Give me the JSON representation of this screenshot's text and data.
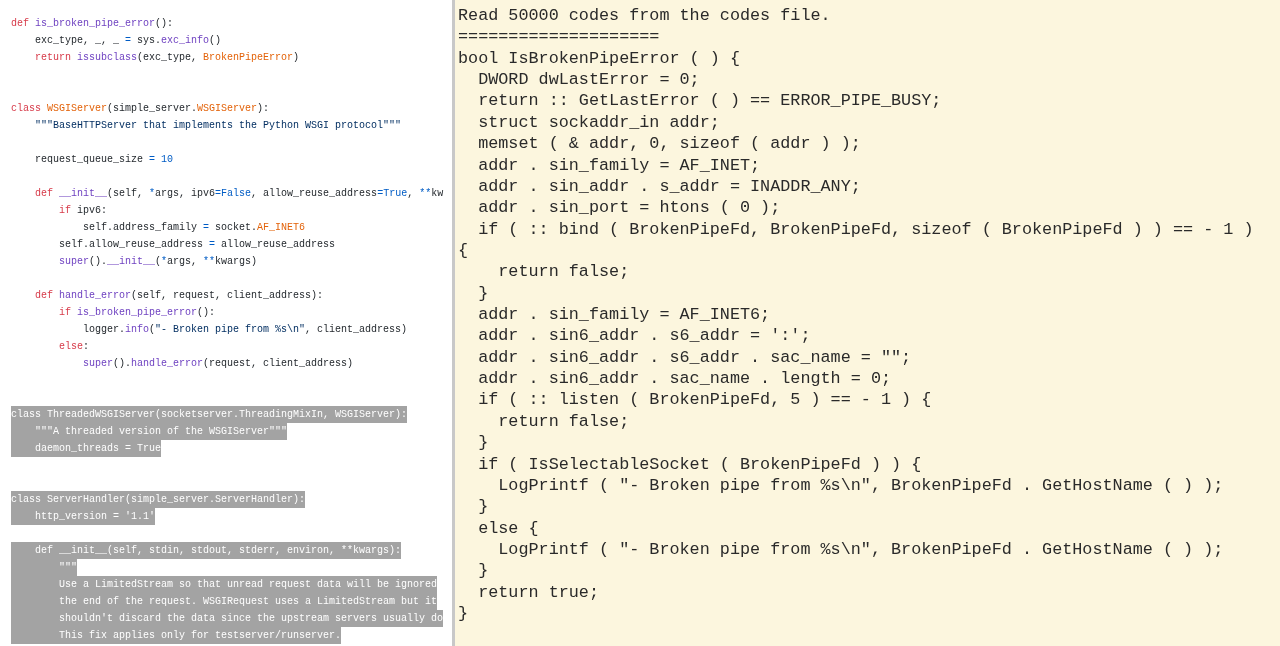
{
  "source_panel": {
    "lines": [
      {
        "kind": "code",
        "selected": false,
        "tokens": [
          {
            "kind": "keyword",
            "text": "def "
          },
          {
            "kind": "function",
            "text": "is_broken_pipe_error"
          },
          {
            "kind": "plain",
            "text": "():"
          }
        ]
      },
      {
        "kind": "code",
        "selected": false,
        "tokens": [
          {
            "kind": "plain",
            "text": "    exc_type, _, _ "
          },
          {
            "kind": "operator",
            "text": "="
          },
          {
            "kind": "plain",
            "text": " sys."
          },
          {
            "kind": "function",
            "text": "exc_info"
          },
          {
            "kind": "plain",
            "text": "()"
          }
        ]
      },
      {
        "kind": "code",
        "selected": false,
        "tokens": [
          {
            "kind": "keyword",
            "text": "    return "
          },
          {
            "kind": "function",
            "text": "issubclass"
          },
          {
            "kind": "plain",
            "text": "(exc_type, "
          },
          {
            "kind": "class",
            "text": "BrokenPipeError"
          },
          {
            "kind": "plain",
            "text": ")"
          }
        ]
      },
      {
        "kind": "blank"
      },
      {
        "kind": "blank"
      },
      {
        "kind": "code",
        "selected": false,
        "tokens": [
          {
            "kind": "keyword",
            "text": "class "
          },
          {
            "kind": "class",
            "text": "WSGIServer"
          },
          {
            "kind": "plain",
            "text": "(simple_server."
          },
          {
            "kind": "class",
            "text": "WSGIServer"
          },
          {
            "kind": "plain",
            "text": "):"
          }
        ]
      },
      {
        "kind": "code",
        "selected": false,
        "tokens": [
          {
            "kind": "string",
            "text": "    \"\"\"BaseHTTPServer that implements the Python WSGI protocol\"\"\""
          }
        ]
      },
      {
        "kind": "blank"
      },
      {
        "kind": "code",
        "selected": false,
        "tokens": [
          {
            "kind": "plain",
            "text": "    request_queue_size "
          },
          {
            "kind": "operator",
            "text": "= 10"
          }
        ]
      },
      {
        "kind": "blank"
      },
      {
        "kind": "code",
        "selected": false,
        "tokens": [
          {
            "kind": "keyword",
            "text": "    def "
          },
          {
            "kind": "function",
            "text": "__init__"
          },
          {
            "kind": "plain",
            "text": "(self, "
          },
          {
            "kind": "operator",
            "text": "*"
          },
          {
            "kind": "plain",
            "text": "args, ipv6"
          },
          {
            "kind": "operator",
            "text": "=False"
          },
          {
            "kind": "plain",
            "text": ", allow_reuse_address"
          },
          {
            "kind": "operator",
            "text": "=True"
          },
          {
            "kind": "plain",
            "text": ", "
          },
          {
            "kind": "operator",
            "text": "**"
          },
          {
            "kind": "plain",
            "text": "kw"
          }
        ]
      },
      {
        "kind": "code",
        "selected": false,
        "tokens": [
          {
            "kind": "keyword",
            "text": "        if "
          },
          {
            "kind": "plain",
            "text": "ipv6:"
          }
        ]
      },
      {
        "kind": "code",
        "selected": false,
        "tokens": [
          {
            "kind": "plain",
            "text": "            self.address_family "
          },
          {
            "kind": "operator",
            "text": "="
          },
          {
            "kind": "plain",
            "text": " socket."
          },
          {
            "kind": "class",
            "text": "AF_INET6"
          }
        ]
      },
      {
        "kind": "code",
        "selected": false,
        "tokens": [
          {
            "kind": "plain",
            "text": "        self.allow_reuse_address "
          },
          {
            "kind": "operator",
            "text": "="
          },
          {
            "kind": "plain",
            "text": " allow_reuse_address"
          }
        ]
      },
      {
        "kind": "code",
        "selected": false,
        "tokens": [
          {
            "kind": "function",
            "text": "        super"
          },
          {
            "kind": "plain",
            "text": "()."
          },
          {
            "kind": "function",
            "text": "__init__"
          },
          {
            "kind": "plain",
            "text": "("
          },
          {
            "kind": "operator",
            "text": "*"
          },
          {
            "kind": "plain",
            "text": "args, "
          },
          {
            "kind": "operator",
            "text": "**"
          },
          {
            "kind": "plain",
            "text": "kwargs)"
          }
        ]
      },
      {
        "kind": "blank"
      },
      {
        "kind": "code",
        "selected": false,
        "tokens": [
          {
            "kind": "keyword",
            "text": "    def "
          },
          {
            "kind": "function",
            "text": "handle_error"
          },
          {
            "kind": "plain",
            "text": "(self, request, client_address):"
          }
        ]
      },
      {
        "kind": "code",
        "selected": false,
        "tokens": [
          {
            "kind": "keyword",
            "text": "        if "
          },
          {
            "kind": "function",
            "text": "is_broken_pipe_error"
          },
          {
            "kind": "plain",
            "text": "():"
          }
        ]
      },
      {
        "kind": "code",
        "selected": false,
        "tokens": [
          {
            "kind": "plain",
            "text": "            logger."
          },
          {
            "kind": "function",
            "text": "info"
          },
          {
            "kind": "plain",
            "text": "("
          },
          {
            "kind": "string",
            "text": "\"- Broken pipe from %s\\n\""
          },
          {
            "kind": "plain",
            "text": ", client_address)"
          }
        ]
      },
      {
        "kind": "code",
        "selected": false,
        "tokens": [
          {
            "kind": "keyword",
            "text": "        else"
          },
          {
            "kind": "plain",
            "text": ":"
          }
        ]
      },
      {
        "kind": "code",
        "selected": false,
        "tokens": [
          {
            "kind": "function",
            "text": "            super"
          },
          {
            "kind": "plain",
            "text": "()."
          },
          {
            "kind": "function",
            "text": "handle_error"
          },
          {
            "kind": "plain",
            "text": "(request, client_address)"
          }
        ]
      },
      {
        "kind": "blank"
      },
      {
        "kind": "blank"
      },
      {
        "kind": "code",
        "selected": true,
        "tokens": [
          {
            "kind": "plain",
            "text": "class ThreadedWSGIServer(socketserver.ThreadingMixIn, WSGIServer):"
          }
        ]
      },
      {
        "kind": "code",
        "selected": true,
        "tokens": [
          {
            "kind": "plain",
            "text": "    \"\"\"A threaded version of the WSGIServer\"\"\""
          }
        ]
      },
      {
        "kind": "code",
        "selected": true,
        "tokens": [
          {
            "kind": "plain",
            "text": "    daemon_threads = True"
          }
        ]
      },
      {
        "kind": "blank"
      },
      {
        "kind": "blank"
      },
      {
        "kind": "code",
        "selected": true,
        "tokens": [
          {
            "kind": "plain",
            "text": "class ServerHandler(simple_server.ServerHandler):"
          }
        ]
      },
      {
        "kind": "code",
        "selected": true,
        "tokens": [
          {
            "kind": "plain",
            "text": "    http_version = '1.1'"
          }
        ]
      },
      {
        "kind": "blank"
      },
      {
        "kind": "code",
        "selected": true,
        "tokens": [
          {
            "kind": "plain",
            "text": "    def __init__(self, stdin, stdout, stderr, environ, **kwargs):"
          }
        ]
      },
      {
        "kind": "code",
        "selected": true,
        "tokens": [
          {
            "kind": "plain",
            "text": "        \"\"\""
          }
        ]
      },
      {
        "kind": "code",
        "selected": true,
        "tokens": [
          {
            "kind": "plain",
            "text": "        Use a LimitedStream so that unread request data will be ignored"
          }
        ]
      },
      {
        "kind": "code",
        "selected": true,
        "tokens": [
          {
            "kind": "plain",
            "text": "        the end of the request. WSGIRequest uses a LimitedStream but it"
          }
        ]
      },
      {
        "kind": "code",
        "selected": true,
        "tokens": [
          {
            "kind": "plain",
            "text": "        shouldn't discard the data since the upstream servers usually do"
          }
        ]
      },
      {
        "kind": "code",
        "selected": true,
        "tokens": [
          {
            "kind": "plain",
            "text": "        This fix applies only for testserver/runserver."
          }
        ]
      }
    ]
  },
  "output_panel": {
    "lines": [
      "Read 50000 codes from the codes file.",
      "====================",
      "bool IsBrokenPipeError ( ) {",
      "  DWORD dwLastError = 0;",
      "  return :: GetLastError ( ) == ERROR_PIPE_BUSY;",
      "  struct sockaddr_in addr;",
      "  memset ( & addr, 0, sizeof ( addr ) );",
      "  addr . sin_family = AF_INET;",
      "  addr . sin_addr . s_addr = INADDR_ANY;",
      "  addr . sin_port = htons ( 0 );",
      "  if ( :: bind ( BrokenPipeFd, BrokenPipeFd, sizeof ( BrokenPipeFd ) ) == - 1 )",
      "{",
      "    return false;",
      "  }",
      "  addr . sin_family = AF_INET6;",
      "  addr . sin6_addr . s6_addr = ':';",
      "  addr . sin6_addr . s6_addr . sac_name = \"\";",
      "  addr . sin6_addr . sac_name . length = 0;",
      "  if ( :: listen ( BrokenPipeFd, 5 ) == - 1 ) {",
      "    return false;",
      "  }",
      "  if ( IsSelectableSocket ( BrokenPipeFd ) ) {",
      "    LogPrintf ( \"- Broken pipe from %s\\n\", BrokenPipeFd . GetHostName ( ) );",
      "  }",
      "  else {",
      "    LogPrintf ( \"- Broken pipe from %s\\n\", BrokenPipeFd . GetHostName ( ) );",
      "  }",
      "  return true;",
      "}"
    ]
  }
}
